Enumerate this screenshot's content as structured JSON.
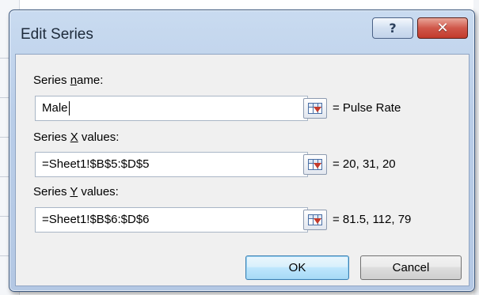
{
  "dialog": {
    "title": "Edit Series",
    "help_label": "?",
    "close_label": "✕"
  },
  "series_name": {
    "label_pre": "Series ",
    "label_accel": "n",
    "label_post": "ame:",
    "value": "Male",
    "result": "= Pulse Rate"
  },
  "series_x": {
    "label_pre": "Series ",
    "label_accel": "X",
    "label_post": " values:",
    "value": "=Sheet1!$B$5:$D$5",
    "result": "= 20, 31, 20"
  },
  "series_y": {
    "label_pre": "Series ",
    "label_accel": "Y",
    "label_post": " values:",
    "value": "=Sheet1!$B$6:$D$6",
    "result": "= 81.5, 112, 79"
  },
  "buttons": {
    "ok": "OK",
    "cancel": "Cancel"
  },
  "colors": {
    "title_bar": "#b9cde8",
    "close_button": "#c23b2c",
    "default_button": "#bee6fd"
  },
  "icons": {
    "help": "help-icon",
    "close": "close-icon",
    "range_select": "collapse-dialog-icon"
  }
}
